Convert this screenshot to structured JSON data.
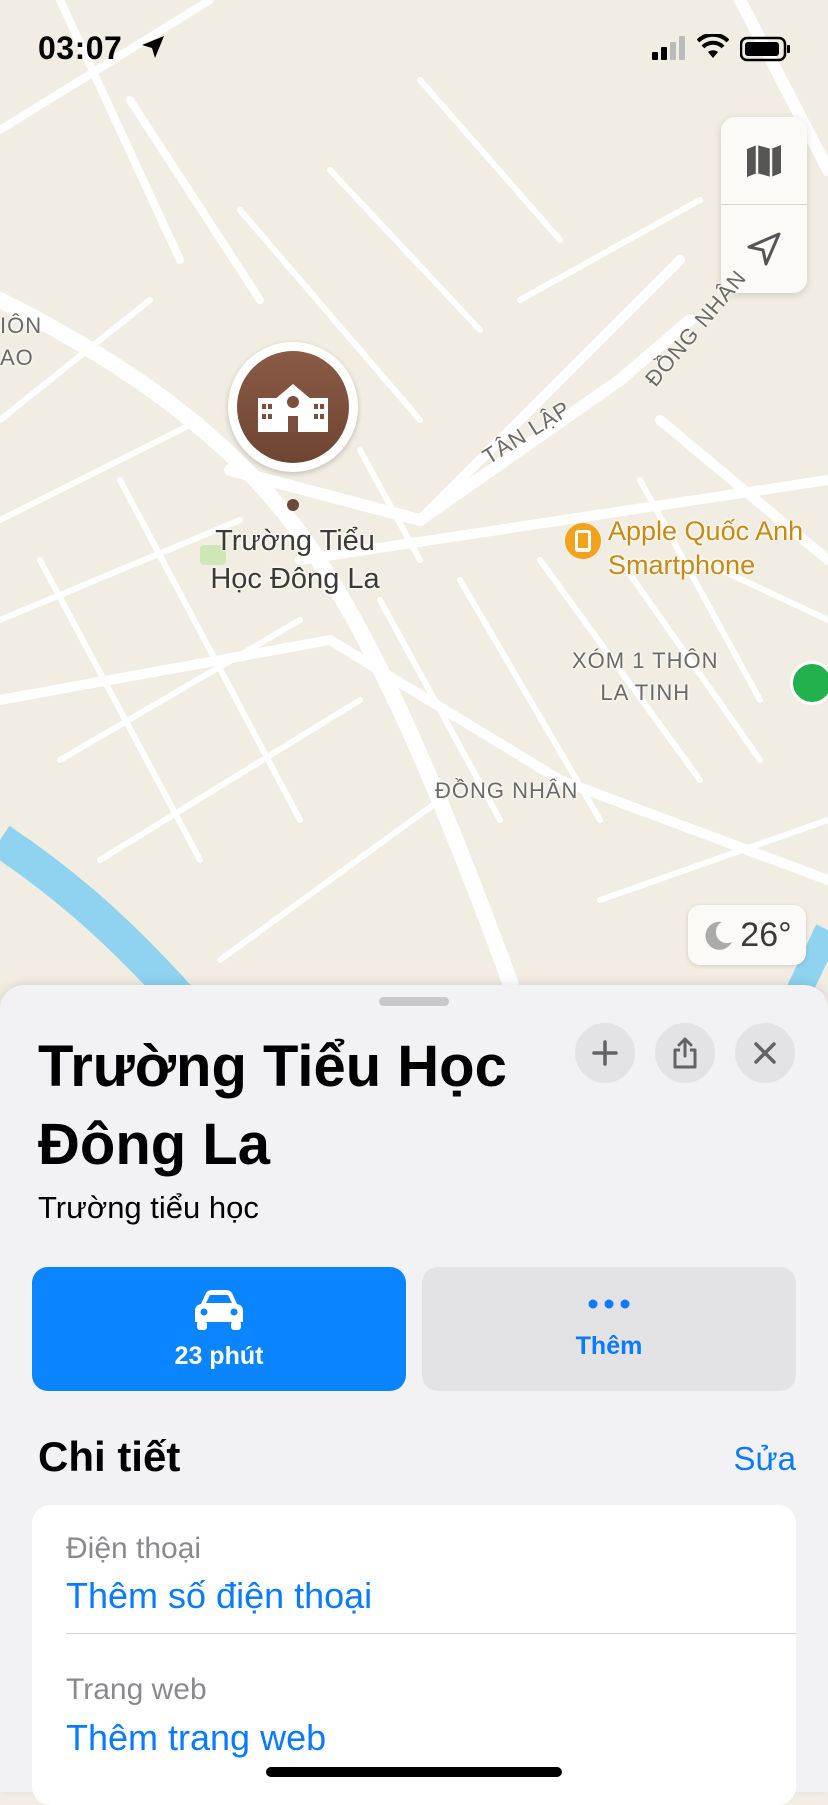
{
  "status_bar": {
    "time": "03:07"
  },
  "map": {
    "place_label": [
      "Trường Tiểu",
      "Học Đông La"
    ],
    "streets": {
      "tan_lap": "TÂN LẬP",
      "dong_nhan_diag": "ĐỒNG NHÂN",
      "dong_nhan": "ĐỒNG NHÂN",
      "xom1_line1": "XÓM 1 THÔN",
      "xom1_line2": "LA TINH",
      "left_partial_1": "IÔN",
      "left_partial_2": "AO"
    },
    "poi_apple": [
      "Apple Quốc Anh",
      "Smartphone"
    ],
    "weather": "26°"
  },
  "sheet": {
    "title": "Trường Tiểu Học Đông La",
    "category": "Trường tiểu học",
    "drive_label": "23 phút",
    "more_label": "Thêm",
    "details_title": "Chi tiết",
    "edit_label": "Sửa",
    "phone_label": "Điện thoại",
    "phone_value": "Thêm số điện thoại",
    "web_label": "Trang web",
    "web_value": "Thêm trang web"
  },
  "colors": {
    "accent": "#0a84ff",
    "pin": "#7a4f3b",
    "poi": "#f3a21b",
    "water": "#8fd3f0"
  }
}
